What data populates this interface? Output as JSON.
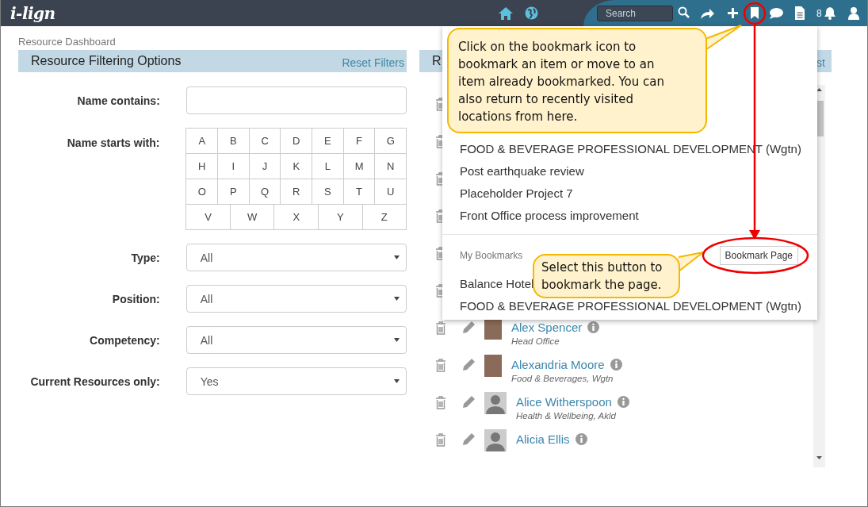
{
  "app": {
    "logo": "i-lign",
    "search": {
      "placeholder": "Search"
    },
    "notification_count": "8"
  },
  "breadcrumb": "Resource Dashboard",
  "filter_panel": {
    "title": "Resource Filtering Options",
    "reset_link": "Reset Filters",
    "fields": [
      {
        "kind": "text",
        "label": "Name contains:"
      },
      {
        "kind": "letters",
        "label": "Name starts with:",
        "letter_rows": [
          [
            "A",
            "B",
            "C",
            "D",
            "E",
            "F",
            "G"
          ],
          [
            "H",
            "I",
            "J",
            "K",
            "L",
            "M",
            "N"
          ],
          [
            "O",
            "P",
            "Q",
            "R",
            "S",
            "T",
            "U"
          ],
          [
            "V",
            "W",
            "X",
            "Y",
            "Z"
          ]
        ]
      },
      {
        "kind": "select",
        "label": "Type:",
        "value": "All"
      },
      {
        "kind": "select",
        "label": "Position:",
        "value": "All"
      },
      {
        "kind": "select",
        "label": "Competency:",
        "value": "All"
      },
      {
        "kind": "select",
        "label": "Current Resources only:",
        "value": "Yes"
      }
    ]
  },
  "resource_panel": {
    "title": "R",
    "link": "st",
    "rows": [
      {
        "kind": "covered"
      },
      {
        "kind": "covered"
      },
      {
        "kind": "covered"
      },
      {
        "kind": "covered"
      },
      {
        "kind": "covered"
      },
      {
        "kind": "covered"
      },
      {
        "kind": "photo",
        "name": "Alex Spencer",
        "detail": "Head Office"
      },
      {
        "kind": "photo",
        "name": "Alexandria Moore",
        "detail": "Food & Beverages, Wgtn"
      },
      {
        "kind": "silhouette",
        "name": "Alice Witherspoon",
        "detail": "Health & Wellbeing, Akld"
      },
      {
        "kind": "silhouette",
        "name": "Alicia Ellis"
      }
    ]
  },
  "bookmark_menu": {
    "recent": [
      "FOOD & BEVERAGE PROFESSIONAL DEVELOPMENT (Wgtn)",
      "Post earthquake review",
      "Placeholder Project 7",
      "Front Office process improvement"
    ],
    "section_title": "My Bookmarks",
    "button": "Bookmark Page",
    "bookmarks": [
      "Balance Hotel",
      "FOOD & BEVERAGE PROFESSIONAL DEVELOPMENT (Wgtn)"
    ]
  },
  "callouts": [
    {
      "text": "Click on the bookmark icon to bookmark an item or move to an item already bookmarked. You can also return to recently visited locations from here."
    },
    {
      "text": "Select this button to bookmark the page."
    }
  ]
}
